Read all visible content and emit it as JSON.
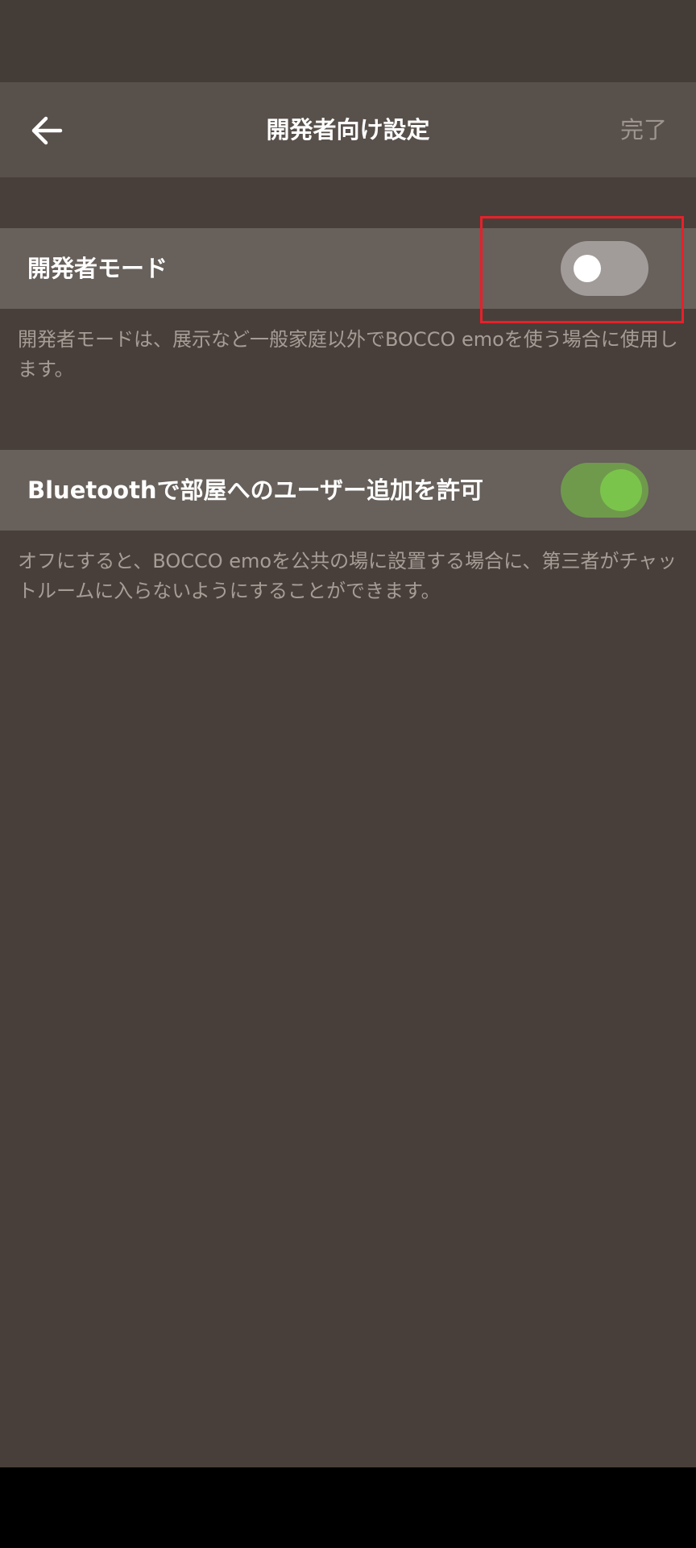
{
  "header": {
    "back_icon": "arrow-left-icon",
    "title": "開発者向け設定",
    "done_label": "完了"
  },
  "settings": [
    {
      "label": "開発者モード",
      "enabled": false,
      "description": "開発者モードは、展示など一般家庭以外でBOCCO emoを使う場合に使用します。"
    },
    {
      "label": "Bluetoothで部屋へのユーザー追加を許可",
      "enabled": true,
      "description": "オフにすると、BOCCO emoを公共の場に設置する場合に、第三者がチャットルームに入らないようにすることができます。"
    }
  ],
  "colors": {
    "background": "#483f3a",
    "app_bar": "#58504b",
    "row": "#67605b",
    "toggle_on_track": "#6f9a4c",
    "toggle_on_knob": "#7bc44c",
    "toggle_off_track": "#a19c99",
    "highlight": "#e8202a"
  }
}
